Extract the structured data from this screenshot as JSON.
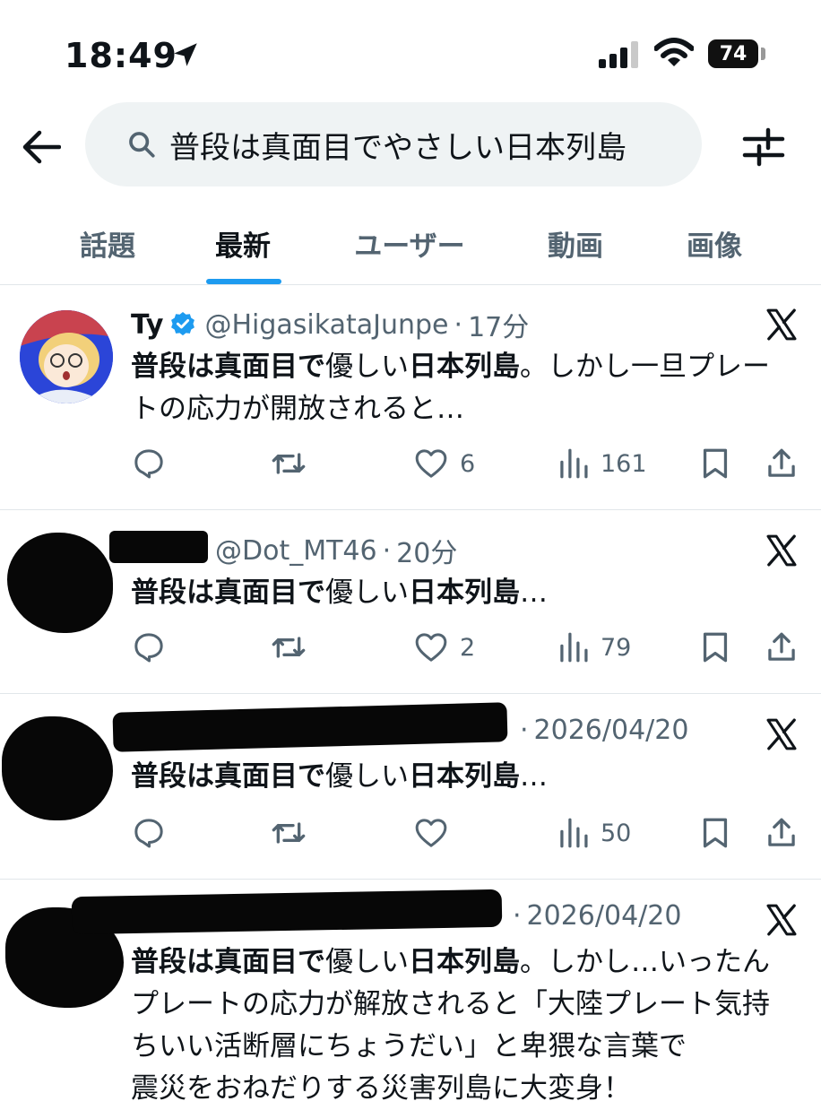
{
  "status_bar": {
    "time": "18:49",
    "battery": "74",
    "icons": [
      "location-arrow-icon",
      "signal-icon",
      "wifi-icon",
      "battery-icon"
    ]
  },
  "search": {
    "query": "普段は真面目でやさしい日本列島",
    "icons": [
      "back-arrow-icon",
      "search-icon",
      "filter-icon"
    ]
  },
  "tabs": [
    {
      "label": "話題",
      "active": false
    },
    {
      "label": "最新",
      "active": true
    },
    {
      "label": "ユーザー",
      "active": false
    },
    {
      "label": "動画",
      "active": false
    },
    {
      "label": "画像",
      "active": false
    }
  ],
  "colors": {
    "accent": "#1d9bf0",
    "text": "#0f1419",
    "muted": "#536471",
    "search_bg": "#eff3f4",
    "divider": "#e1e6ea"
  },
  "tweets": [
    {
      "name": "Ty",
      "verified": true,
      "handle": "@HigasikataJunpe",
      "sep": "·",
      "time": "17分",
      "text_bold": "普段は真面目で",
      "text_rest_1": "優しい",
      "text_bold_2": "日本列島",
      "text_tail": "。しかし一旦プレートの応力が開放されると…",
      "likes": "6",
      "views": "161"
    },
    {
      "name": "",
      "verified": false,
      "handle": "@Dot_MT46",
      "sep": "·",
      "time": "20分",
      "text_bold": "普段は真面目で",
      "text_rest_1": "優しい",
      "text_bold_2": "日本列島",
      "text_tail": "…",
      "likes": "2",
      "views": "79"
    },
    {
      "name": "",
      "verified": false,
      "handle": "",
      "sep": "·",
      "time": "2026/04/20",
      "text_bold": "普段は真面目で",
      "text_rest_1": "優しい",
      "text_bold_2": "日本列島",
      "text_tail": "…",
      "likes": "",
      "views": "50"
    },
    {
      "name": "",
      "verified": false,
      "handle": "",
      "sep": "·",
      "time": "2026/04/20",
      "text_bold": "普段は真面目で",
      "text_rest_1": "優しい",
      "text_bold_2": "日本列島",
      "text_tail": "。しかし…いったんプレートの応力が解放されると「大陸プレート気持ちいい活断層にちょうだい」と卑猥な言葉で",
      "text_cut": "震災をおねだりする災害列島に大変身！"
    }
  ]
}
